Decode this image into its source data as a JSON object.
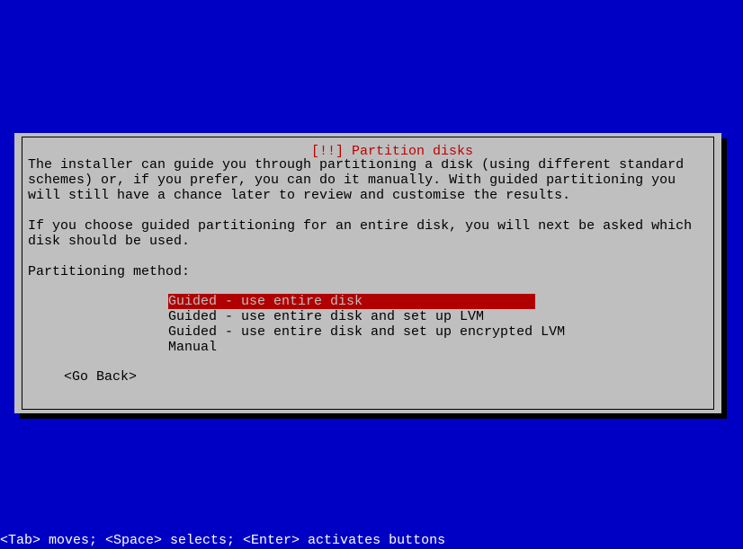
{
  "dialog": {
    "title": "[!!] Partition disks",
    "paragraph1": "The installer can guide you through partitioning a disk (using different standard schemes) or, if you prefer, you can do it manually. With guided partitioning you will still have a chance later to review and customise the results.",
    "paragraph2": "If you choose guided partitioning for an entire disk, you will next be asked which disk should be used.",
    "prompt": "Partitioning method:",
    "options": [
      "Guided - use entire disk",
      "Guided - use entire disk and set up LVM",
      "Guided - use entire disk and set up encrypted LVM",
      "Manual"
    ],
    "selected_index": 0,
    "go_back_label": "<Go Back>"
  },
  "help_line": "<Tab> moves; <Space> selects; <Enter> activates buttons"
}
